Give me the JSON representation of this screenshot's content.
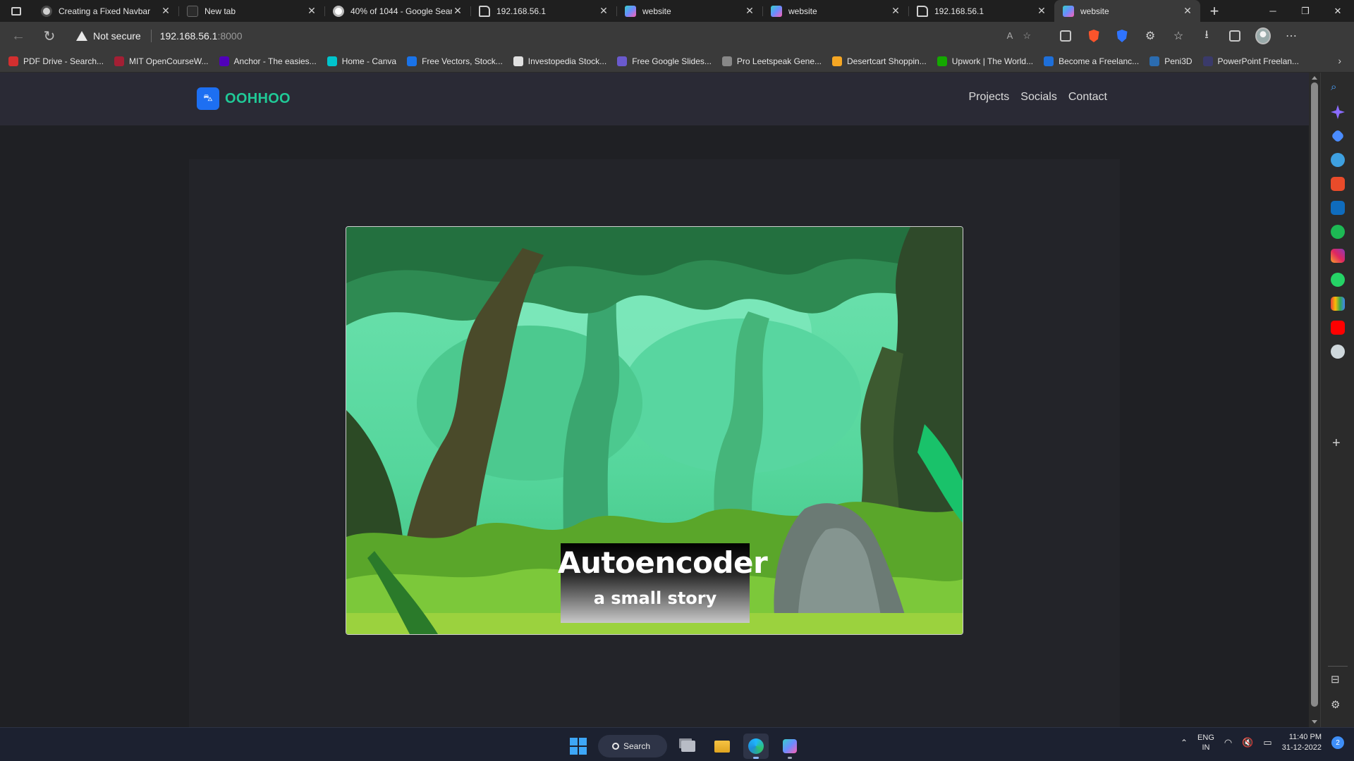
{
  "browser": {
    "tabs": [
      {
        "title": "Creating a Fixed Navbar",
        "favicon": "chatgpt-icon",
        "active": false
      },
      {
        "title": "New tab",
        "favicon": "newtab-icon",
        "active": false
      },
      {
        "title": "40% of 1044 - Google Sear",
        "favicon": "google-icon",
        "active": false
      },
      {
        "title": "192.168.56.1",
        "favicon": "document-icon",
        "active": false
      },
      {
        "title": "website",
        "favicon": "website-icon",
        "active": false
      },
      {
        "title": "website",
        "favicon": "website-icon",
        "active": false
      },
      {
        "title": "192.168.56.1",
        "favicon": "document-icon",
        "active": false
      },
      {
        "title": "website",
        "favicon": "website-icon",
        "active": true
      }
    ],
    "address": {
      "security_label": "Not secure",
      "host": "192.168.56.1",
      "port": ":8000"
    },
    "bookmarks": [
      {
        "label": "PDF Drive - Search...",
        "color": "#d32f2f"
      },
      {
        "label": "MIT OpenCourseW...",
        "color": "#a31f34"
      },
      {
        "label": "Anchor - The easies...",
        "color": "#5000b9"
      },
      {
        "label": "Home - Canva",
        "color": "#00c4cc"
      },
      {
        "label": "Free Vectors, Stock...",
        "color": "#1a73e8"
      },
      {
        "label": "Investopedia Stock...",
        "color": "#e0e0e0"
      },
      {
        "label": "Free Google Slides...",
        "color": "#6a5acd"
      },
      {
        "label": "Pro Leetspeak Gene...",
        "color": "#888888"
      },
      {
        "label": "Desertcart Shoppin...",
        "color": "#f5a623"
      },
      {
        "label": "Upwork | The World...",
        "color": "#14a800"
      },
      {
        "label": "Become a Freelanc...",
        "color": "#1e6fd9"
      },
      {
        "label": "Peni3D",
        "color": "#2b6cb0"
      },
      {
        "label": "PowerPoint Freelan...",
        "color": "#3a3a6a"
      }
    ]
  },
  "site": {
    "brand": "OOHHOO",
    "logo_glyph": "⛍",
    "nav": [
      "Projects",
      "Socials",
      "Contact"
    ],
    "hero": {
      "title": "Autoencoder",
      "subtitle": "a small story"
    },
    "colors": {
      "brand_green": "#20c997",
      "logo_blue": "#1d6ff2",
      "navbar_bg": "#2a2a35"
    }
  },
  "taskbar": {
    "search_label": "Search",
    "language": "ENG",
    "region": "IN",
    "time": "11:40 PM",
    "date": "31-12-2022",
    "notifications": "2"
  }
}
